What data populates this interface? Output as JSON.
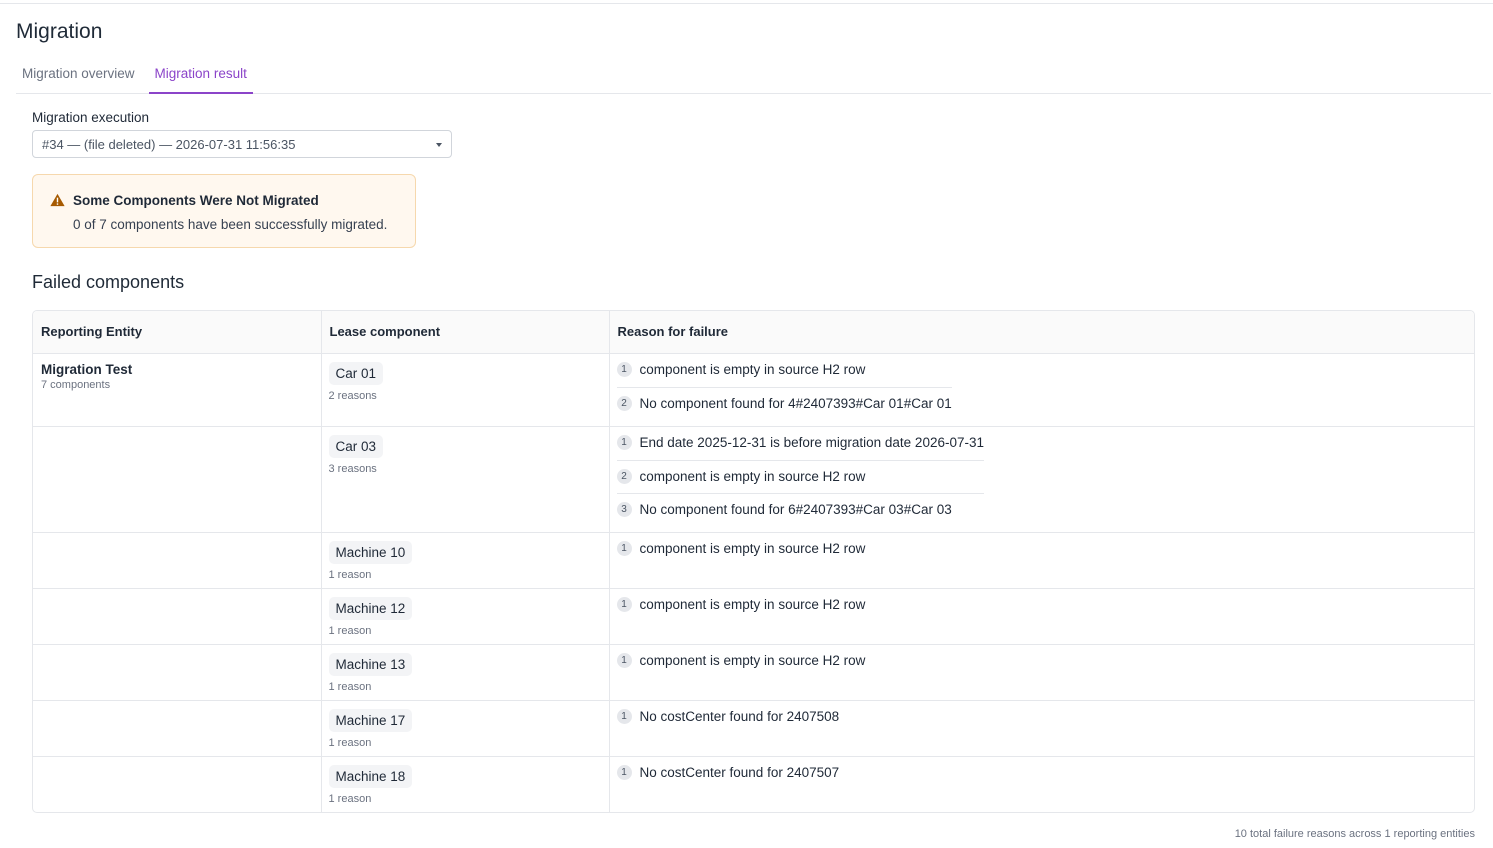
{
  "page": {
    "title": "Migration"
  },
  "tabs": [
    {
      "label": "Migration overview",
      "active": false
    },
    {
      "label": "Migration result",
      "active": true
    }
  ],
  "execution": {
    "label": "Migration execution",
    "selected": "#34 — (file deleted) — 2026-07-31 11:56:35"
  },
  "alert": {
    "icon": "warning-triangle-icon",
    "title": "Some Components Were Not Migrated",
    "message": "0 of 7 components have been successfully migrated."
  },
  "failed": {
    "title": "Failed components",
    "columns": [
      "Reporting Entity",
      "Lease component",
      "Reason for failure"
    ],
    "rows": [
      {
        "entity": "Migration Test",
        "entity_sub": "7 components",
        "component": "Car 01",
        "reason_count": "2 reasons",
        "reasons": [
          {
            "n": "1",
            "text": "component is empty in source H2 row"
          },
          {
            "n": "2",
            "text": "No component found for 4#2407393#Car 01#Car 01"
          }
        ]
      },
      {
        "entity": "",
        "entity_sub": "",
        "component": "Car 03",
        "reason_count": "3 reasons",
        "reasons": [
          {
            "n": "1",
            "text": "End date 2025-12-31 is before migration date 2026-07-31"
          },
          {
            "n": "2",
            "text": "component is empty in source H2 row"
          },
          {
            "n": "3",
            "text": "No component found for 6#2407393#Car 03#Car 03"
          }
        ]
      },
      {
        "entity": "",
        "entity_sub": "",
        "component": "Machine 10",
        "reason_count": "1 reason",
        "reasons": [
          {
            "n": "1",
            "text": "component is empty in source H2 row"
          }
        ]
      },
      {
        "entity": "",
        "entity_sub": "",
        "component": "Machine 12",
        "reason_count": "1 reason",
        "reasons": [
          {
            "n": "1",
            "text": "component is empty in source H2 row"
          }
        ]
      },
      {
        "entity": "",
        "entity_sub": "",
        "component": "Machine 13",
        "reason_count": "1 reason",
        "reasons": [
          {
            "n": "1",
            "text": "component is empty in source H2 row"
          }
        ]
      },
      {
        "entity": "",
        "entity_sub": "",
        "component": "Machine 17",
        "reason_count": "1 reason",
        "reasons": [
          {
            "n": "1",
            "text": "No costCenter found for 2407508"
          }
        ]
      },
      {
        "entity": "",
        "entity_sub": "",
        "component": "Machine 18",
        "reason_count": "1 reason",
        "reasons": [
          {
            "n": "1",
            "text": "No costCenter found for 2407507"
          }
        ]
      }
    ],
    "footer": "10 total failure reasons across 1 reporting entities"
  },
  "colors": {
    "accent": "#8b44c9",
    "warning": "#a65a00",
    "alert_bg": "#fff8ef"
  }
}
